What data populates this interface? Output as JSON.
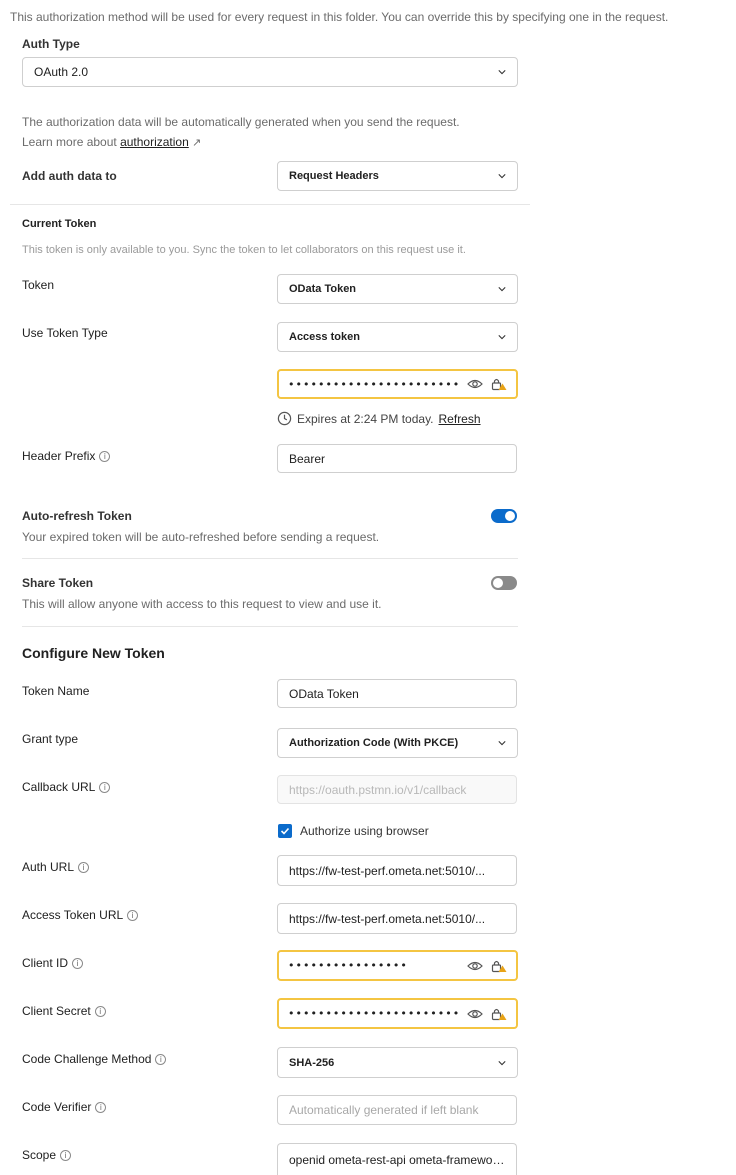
{
  "top_note": "This authorization method will be used for every request in this folder. You can override this by specifying one in the request.",
  "auth_type": {
    "label": "Auth Type",
    "value": "OAuth 2.0"
  },
  "auto_gen_note": "The authorization data will be automatically generated when you send the request.",
  "learn_more": {
    "prefix": "Learn more about ",
    "link": "authorization",
    "arrow": "↗"
  },
  "add_auth": {
    "label": "Add auth data to",
    "value": "Request Headers"
  },
  "current_token": {
    "heading": "Current Token",
    "note": "This token is only available to you. Sync the token to let collaborators on this request use it.",
    "token_label": "Token",
    "token_value": "OData Token",
    "use_token_type_label": "Use Token Type",
    "use_token_type_value": "Access token",
    "masked_token": "••••••••••••••••••••••••••",
    "expires_text": "Expires at 2:24 PM today.",
    "refresh_link": "Refresh",
    "header_prefix_label": "Header Prefix",
    "header_prefix_value": "Bearer"
  },
  "auto_refresh": {
    "title": "Auto-refresh Token",
    "desc": "Your expired token will be auto-refreshed before sending a request.",
    "enabled": true
  },
  "share_token": {
    "title": "Share Token",
    "desc": "This will allow anyone with access to this request to view and use it.",
    "enabled": false
  },
  "configure": {
    "heading": "Configure New Token",
    "token_name_label": "Token Name",
    "token_name_value": "OData Token",
    "grant_type_label": "Grant type",
    "grant_type_value": "Authorization Code (With PKCE)",
    "callback_label": "Callback URL",
    "callback_placeholder": "https://oauth.pstmn.io/v1/callback",
    "authorize_browser_label": "Authorize using browser",
    "authorize_browser_checked": true,
    "auth_url_label": "Auth URL",
    "auth_url_value": "https://fw-test-perf.ometa.net:5010/...",
    "access_token_url_label": "Access Token URL",
    "access_token_url_value": "https://fw-test-perf.ometa.net:5010/...",
    "client_id_label": "Client ID",
    "client_id_masked": "••••••••••••••••",
    "client_secret_label": "Client Secret",
    "client_secret_masked": "••••••••••••••••••••••••••",
    "code_challenge_label": "Code Challenge Method",
    "code_challenge_value": "SHA-256",
    "code_verifier_label": "Code Verifier",
    "code_verifier_placeholder": "Automatically generated if left blank",
    "scope_label": "Scope",
    "scope_value": "openid ometa-rest-api ometa-framework..."
  },
  "colors": {
    "accent": "#0b6bcb",
    "warning_border": "#f4c542",
    "toggle_off": "#8a8a8a"
  }
}
